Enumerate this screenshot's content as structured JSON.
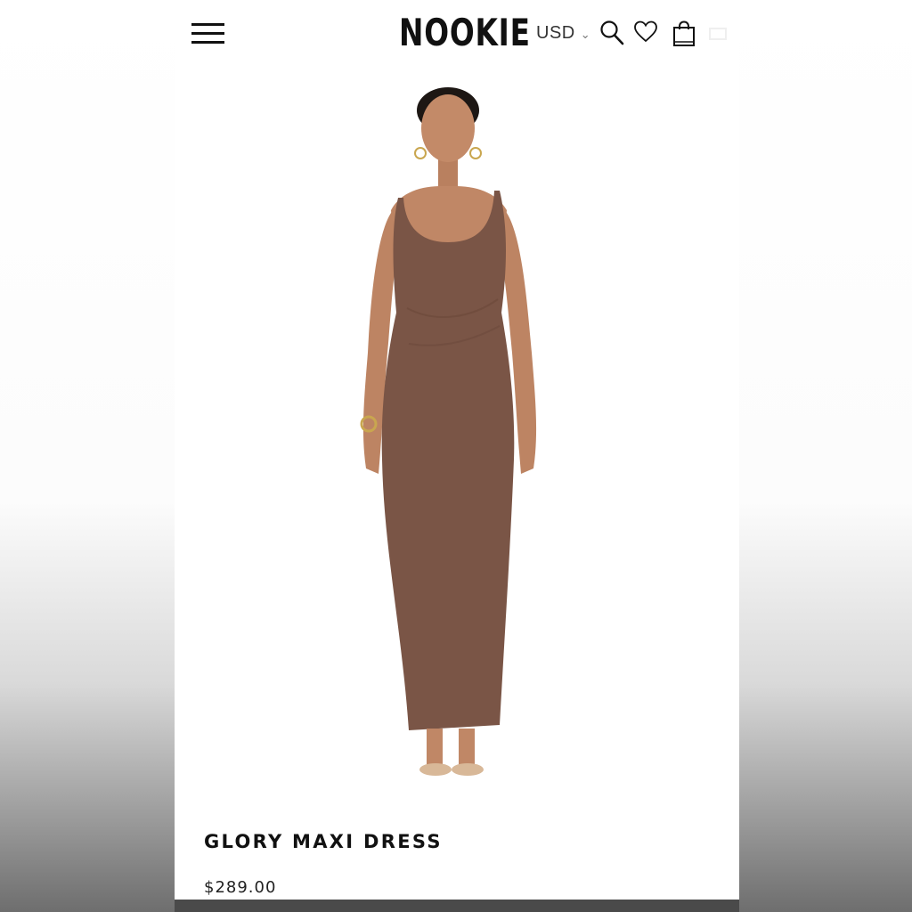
{
  "header": {
    "brand": "NOOKIE",
    "currency": "USD",
    "icons": [
      "menu-icon",
      "search-icon",
      "heart-icon",
      "bag-icon"
    ]
  },
  "product": {
    "image_alt": "Model wearing brown square-neck maxi dress",
    "title": "GLORY MAXI DRESS",
    "price": "$289.00",
    "dress_color": "#7a5546"
  },
  "colors": {
    "text": "#111111",
    "background": "#ffffff"
  }
}
